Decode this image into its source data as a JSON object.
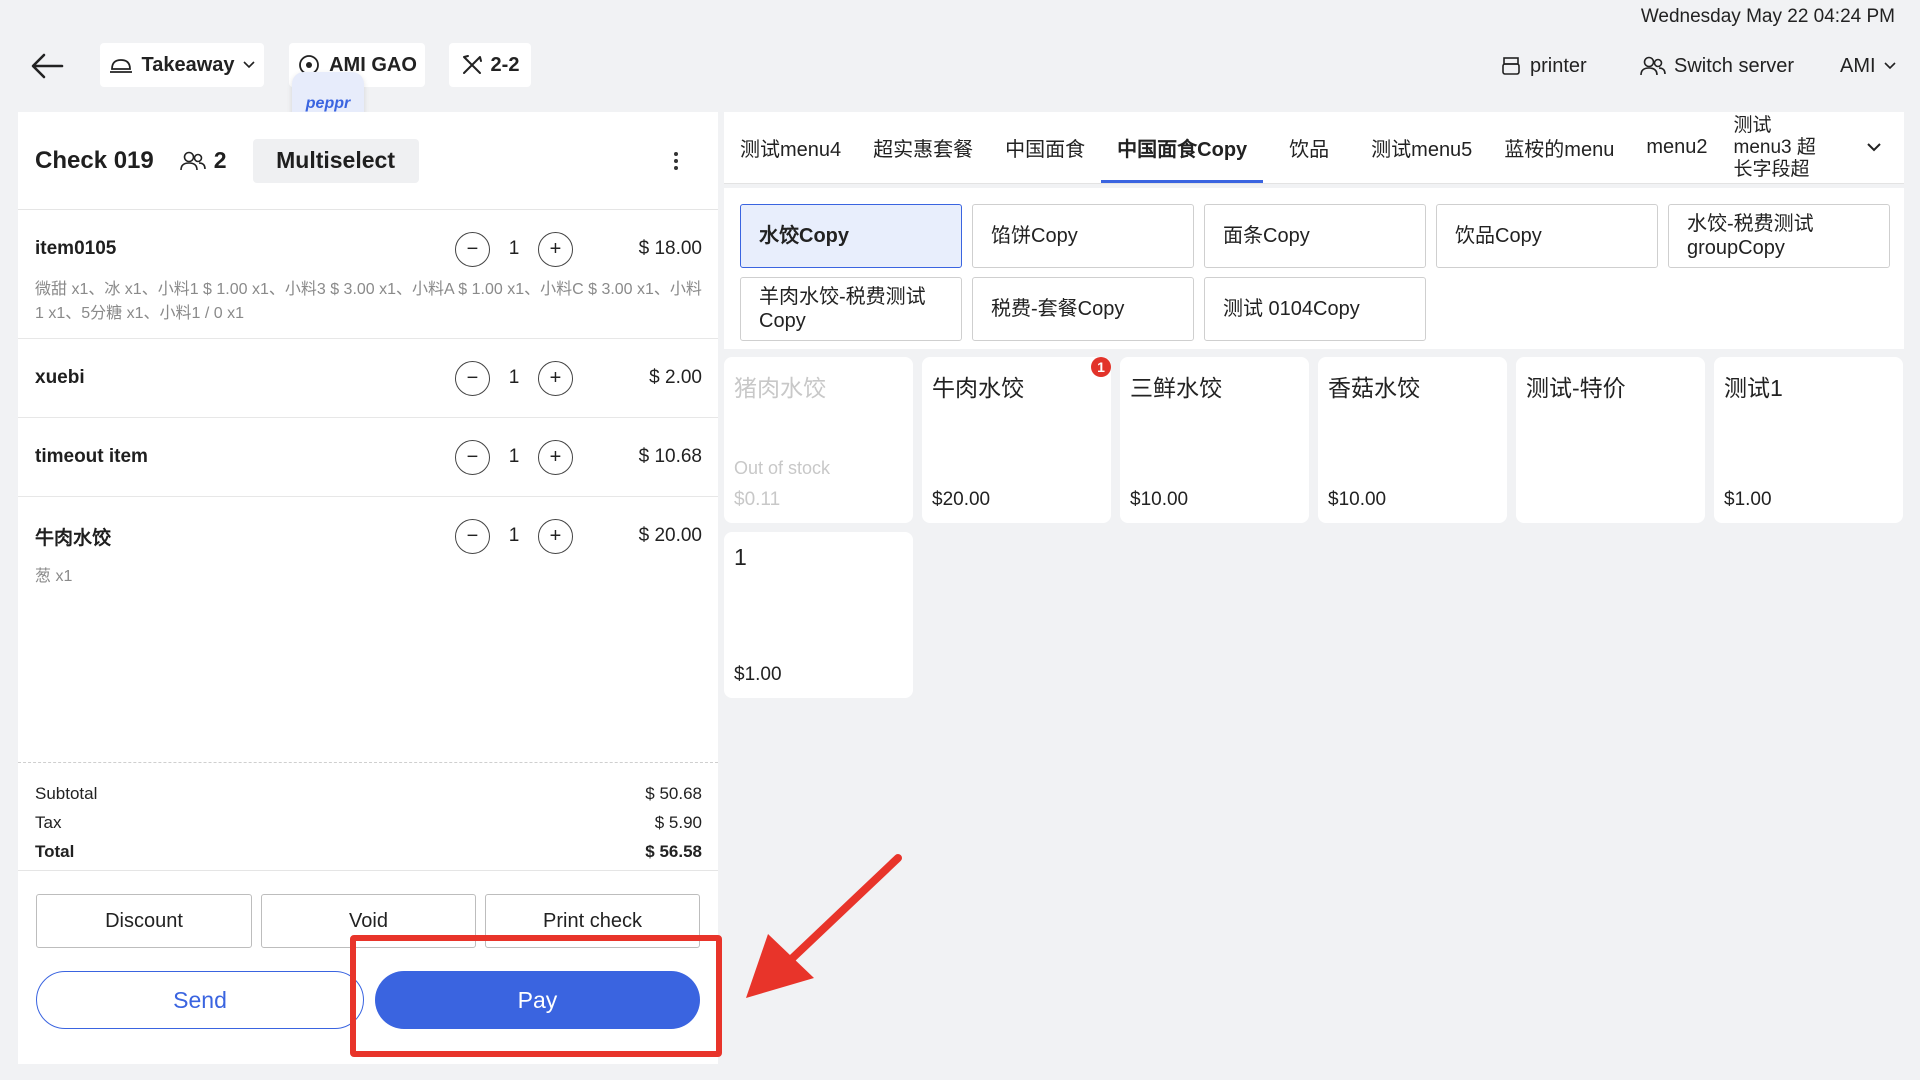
{
  "header": {
    "datetime": "Wednesday May 22 04:24 PM",
    "order_type": "Takeaway",
    "server_name": "AMI GAO",
    "table": "2-2",
    "peppr_label": "peppr",
    "printer_label": "printer",
    "switch_server_label": "Switch server",
    "user_label": "AMI"
  },
  "check": {
    "title": "Check 019",
    "guests": "2",
    "multiselect_label": "Multiselect",
    "items": [
      {
        "name": "item0105",
        "qty": "1",
        "price": "$ 18.00",
        "mods": "微甜 x1、冰 x1、小料1 $ 1.00 x1、小料3 $ 3.00 x1、小料A $ 1.00 x1、小料C $ 3.00 x1、小料1 x1、5分糖 x1、小料1 / 0 x1"
      },
      {
        "name": "xuebi",
        "qty": "1",
        "price": "$ 2.00",
        "mods": ""
      },
      {
        "name": "timeout item",
        "qty": "1",
        "price": "$ 10.68",
        "mods": ""
      },
      {
        "name": "牛肉水饺",
        "qty": "1",
        "price": "$ 20.00",
        "mods": "葱 x1"
      }
    ],
    "subtotal_label": "Subtotal",
    "subtotal": "$ 50.68",
    "tax_label": "Tax",
    "tax": "$ 5.90",
    "total_label": "Total",
    "total": "$ 56.58",
    "discount_label": "Discount",
    "void_label": "Void",
    "print_label": "Print check",
    "send_label": "Send",
    "pay_label": "Pay"
  },
  "menu": {
    "tabs": [
      "测试menu4",
      "超实惠套餐",
      "中国面食",
      "中国面食Copy",
      "饮品",
      "测试menu5",
      "蓝桉的menu",
      "menu2",
      "测试menu3 超长字段超"
    ],
    "active_tab": "中国面食Copy",
    "categories": [
      "水饺Copy",
      "馅饼Copy",
      "面条Copy",
      "饮品Copy",
      "水饺-税费测试 groupCopy",
      "羊肉水饺-税费测试 Copy",
      "税费-套餐Copy",
      "测试 0104Copy"
    ],
    "active_category": "水饺Copy",
    "items": [
      {
        "name": "猪肉水饺",
        "price": "$0.11",
        "status": "Out of stock"
      },
      {
        "name": "牛肉水饺",
        "price": "$20.00",
        "badge": "1"
      },
      {
        "name": "三鲜水饺",
        "price": "$10.00"
      },
      {
        "name": "香菇水饺",
        "price": "$10.00"
      },
      {
        "name": "测试-特价",
        "price": ""
      },
      {
        "name": "测试1",
        "price": "$1.00"
      },
      {
        "name": "1",
        "price": "$1.00"
      }
    ]
  },
  "colors": {
    "accent": "#3a64e0",
    "annotation": "#e8342a",
    "badge": "#e2332a"
  }
}
